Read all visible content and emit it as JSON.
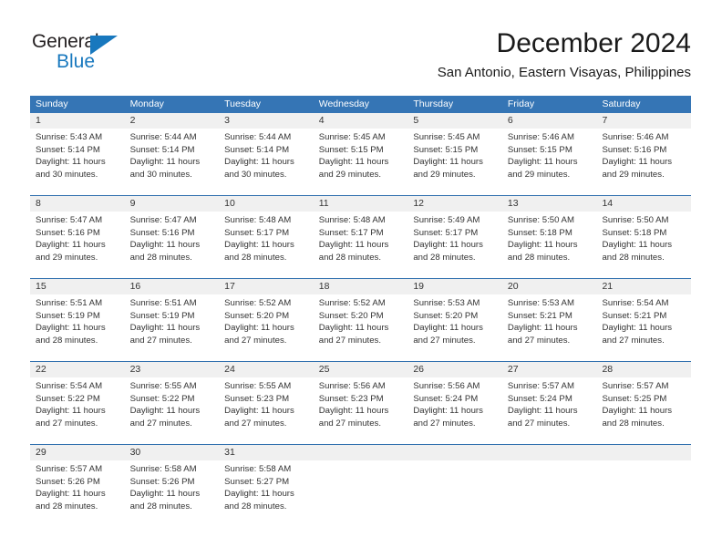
{
  "brand": {
    "name_top": "General",
    "name_bottom": "Blue",
    "triangle_icon": "blue-triangle-logo-mark",
    "accent_color": "#1878be"
  },
  "header": {
    "title": "December 2024",
    "subtitle": "San Antonio, Eastern Visayas, Philippines"
  },
  "theme": {
    "header_bg": "#3575b5",
    "header_text": "#ffffff",
    "daynum_bg": "#f0f0f0",
    "row_rule": "#2f6fae",
    "body_text": "#333333"
  },
  "weekdays": [
    "Sunday",
    "Monday",
    "Tuesday",
    "Wednesday",
    "Thursday",
    "Friday",
    "Saturday"
  ],
  "weeks": [
    {
      "days": [
        {
          "num": "1",
          "sunrise": "Sunrise: 5:43 AM",
          "sunset": "Sunset: 5:14 PM",
          "daylight": "Daylight: 11 hours and 30 minutes."
        },
        {
          "num": "2",
          "sunrise": "Sunrise: 5:44 AM",
          "sunset": "Sunset: 5:14 PM",
          "daylight": "Daylight: 11 hours and 30 minutes."
        },
        {
          "num": "3",
          "sunrise": "Sunrise: 5:44 AM",
          "sunset": "Sunset: 5:14 PM",
          "daylight": "Daylight: 11 hours and 30 minutes."
        },
        {
          "num": "4",
          "sunrise": "Sunrise: 5:45 AM",
          "sunset": "Sunset: 5:15 PM",
          "daylight": "Daylight: 11 hours and 29 minutes."
        },
        {
          "num": "5",
          "sunrise": "Sunrise: 5:45 AM",
          "sunset": "Sunset: 5:15 PM",
          "daylight": "Daylight: 11 hours and 29 minutes."
        },
        {
          "num": "6",
          "sunrise": "Sunrise: 5:46 AM",
          "sunset": "Sunset: 5:15 PM",
          "daylight": "Daylight: 11 hours and 29 minutes."
        },
        {
          "num": "7",
          "sunrise": "Sunrise: 5:46 AM",
          "sunset": "Sunset: 5:16 PM",
          "daylight": "Daylight: 11 hours and 29 minutes."
        }
      ]
    },
    {
      "days": [
        {
          "num": "8",
          "sunrise": "Sunrise: 5:47 AM",
          "sunset": "Sunset: 5:16 PM",
          "daylight": "Daylight: 11 hours and 29 minutes."
        },
        {
          "num": "9",
          "sunrise": "Sunrise: 5:47 AM",
          "sunset": "Sunset: 5:16 PM",
          "daylight": "Daylight: 11 hours and 28 minutes."
        },
        {
          "num": "10",
          "sunrise": "Sunrise: 5:48 AM",
          "sunset": "Sunset: 5:17 PM",
          "daylight": "Daylight: 11 hours and 28 minutes."
        },
        {
          "num": "11",
          "sunrise": "Sunrise: 5:48 AM",
          "sunset": "Sunset: 5:17 PM",
          "daylight": "Daylight: 11 hours and 28 minutes."
        },
        {
          "num": "12",
          "sunrise": "Sunrise: 5:49 AM",
          "sunset": "Sunset: 5:17 PM",
          "daylight": "Daylight: 11 hours and 28 minutes."
        },
        {
          "num": "13",
          "sunrise": "Sunrise: 5:50 AM",
          "sunset": "Sunset: 5:18 PM",
          "daylight": "Daylight: 11 hours and 28 minutes."
        },
        {
          "num": "14",
          "sunrise": "Sunrise: 5:50 AM",
          "sunset": "Sunset: 5:18 PM",
          "daylight": "Daylight: 11 hours and 28 minutes."
        }
      ]
    },
    {
      "days": [
        {
          "num": "15",
          "sunrise": "Sunrise: 5:51 AM",
          "sunset": "Sunset: 5:19 PM",
          "daylight": "Daylight: 11 hours and 28 minutes."
        },
        {
          "num": "16",
          "sunrise": "Sunrise: 5:51 AM",
          "sunset": "Sunset: 5:19 PM",
          "daylight": "Daylight: 11 hours and 27 minutes."
        },
        {
          "num": "17",
          "sunrise": "Sunrise: 5:52 AM",
          "sunset": "Sunset: 5:20 PM",
          "daylight": "Daylight: 11 hours and 27 minutes."
        },
        {
          "num": "18",
          "sunrise": "Sunrise: 5:52 AM",
          "sunset": "Sunset: 5:20 PM",
          "daylight": "Daylight: 11 hours and 27 minutes."
        },
        {
          "num": "19",
          "sunrise": "Sunrise: 5:53 AM",
          "sunset": "Sunset: 5:20 PM",
          "daylight": "Daylight: 11 hours and 27 minutes."
        },
        {
          "num": "20",
          "sunrise": "Sunrise: 5:53 AM",
          "sunset": "Sunset: 5:21 PM",
          "daylight": "Daylight: 11 hours and 27 minutes."
        },
        {
          "num": "21",
          "sunrise": "Sunrise: 5:54 AM",
          "sunset": "Sunset: 5:21 PM",
          "daylight": "Daylight: 11 hours and 27 minutes."
        }
      ]
    },
    {
      "days": [
        {
          "num": "22",
          "sunrise": "Sunrise: 5:54 AM",
          "sunset": "Sunset: 5:22 PM",
          "daylight": "Daylight: 11 hours and 27 minutes."
        },
        {
          "num": "23",
          "sunrise": "Sunrise: 5:55 AM",
          "sunset": "Sunset: 5:22 PM",
          "daylight": "Daylight: 11 hours and 27 minutes."
        },
        {
          "num": "24",
          "sunrise": "Sunrise: 5:55 AM",
          "sunset": "Sunset: 5:23 PM",
          "daylight": "Daylight: 11 hours and 27 minutes."
        },
        {
          "num": "25",
          "sunrise": "Sunrise: 5:56 AM",
          "sunset": "Sunset: 5:23 PM",
          "daylight": "Daylight: 11 hours and 27 minutes."
        },
        {
          "num": "26",
          "sunrise": "Sunrise: 5:56 AM",
          "sunset": "Sunset: 5:24 PM",
          "daylight": "Daylight: 11 hours and 27 minutes."
        },
        {
          "num": "27",
          "sunrise": "Sunrise: 5:57 AM",
          "sunset": "Sunset: 5:24 PM",
          "daylight": "Daylight: 11 hours and 27 minutes."
        },
        {
          "num": "28",
          "sunrise": "Sunrise: 5:57 AM",
          "sunset": "Sunset: 5:25 PM",
          "daylight": "Daylight: 11 hours and 28 minutes."
        }
      ]
    },
    {
      "days": [
        {
          "num": "29",
          "sunrise": "Sunrise: 5:57 AM",
          "sunset": "Sunset: 5:26 PM",
          "daylight": "Daylight: 11 hours and 28 minutes."
        },
        {
          "num": "30",
          "sunrise": "Sunrise: 5:58 AM",
          "sunset": "Sunset: 5:26 PM",
          "daylight": "Daylight: 11 hours and 28 minutes."
        },
        {
          "num": "31",
          "sunrise": "Sunrise: 5:58 AM",
          "sunset": "Sunset: 5:27 PM",
          "daylight": "Daylight: 11 hours and 28 minutes."
        },
        {
          "num": "",
          "sunrise": "",
          "sunset": "",
          "daylight": ""
        },
        {
          "num": "",
          "sunrise": "",
          "sunset": "",
          "daylight": ""
        },
        {
          "num": "",
          "sunrise": "",
          "sunset": "",
          "daylight": ""
        },
        {
          "num": "",
          "sunrise": "",
          "sunset": "",
          "daylight": ""
        }
      ]
    }
  ]
}
